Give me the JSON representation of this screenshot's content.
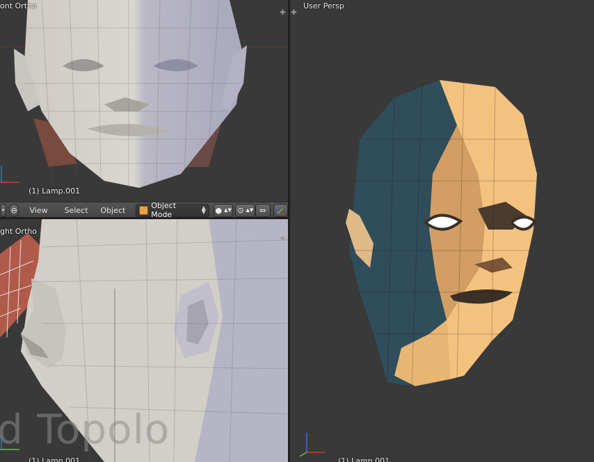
{
  "viewports": {
    "front": {
      "label": "ont Ortho",
      "object": "(1) Lamp.001"
    },
    "right": {
      "label": "ght Ortho",
      "object": "(1) Lamp.001",
      "overlay_text": "d Topolo"
    },
    "persp": {
      "label": "User Persp",
      "object": "(1) Lamp.001"
    }
  },
  "header": {
    "menu": [
      "View",
      "Select",
      "Object"
    ],
    "mode": "Object Mode"
  },
  "colors": {
    "background": "#393939",
    "skin_light": "#f4c27f",
    "skin_shadow": "#2f4d5a",
    "clay": "#bdbab5",
    "x_axis": "#d23a3a",
    "y_axis": "#6cc14a",
    "z_axis": "#3b6fd8"
  },
  "icons": [
    "object-cube-icon",
    "viewport-shade-icon",
    "pivot-icon",
    "manipulator-icon",
    "corner-plus-icon"
  ]
}
